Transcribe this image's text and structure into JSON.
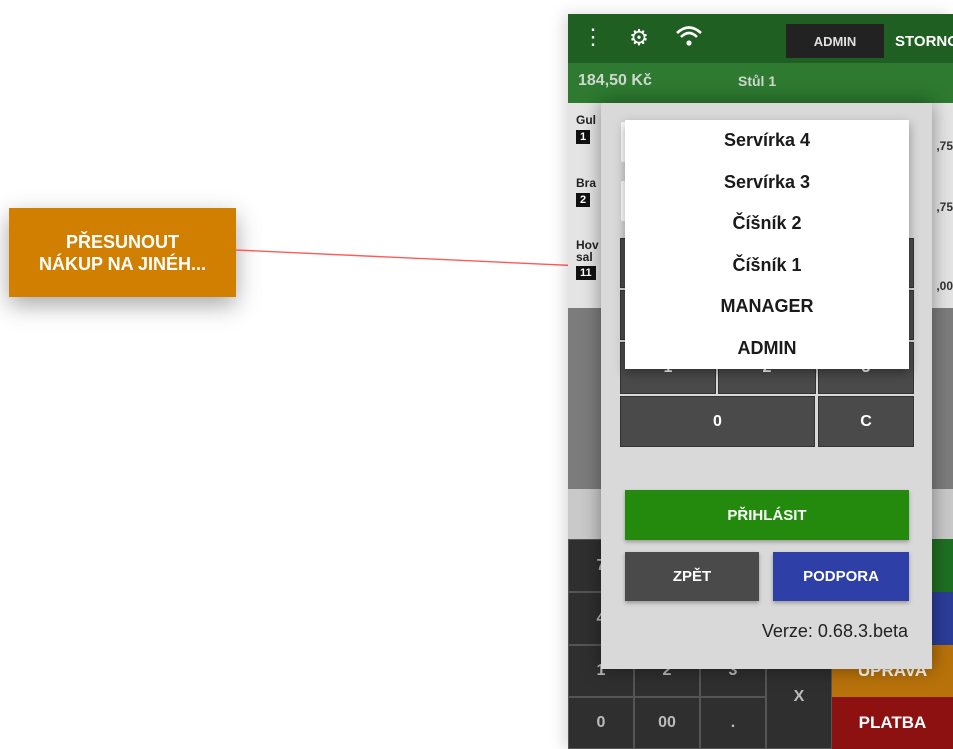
{
  "callout": {
    "line1": "PŘESUNOUT",
    "line2": "NÁKUP NA JINÉH..."
  },
  "topbar": {
    "menu_icon": "more-vertical-icon",
    "settings_icon": "gear-icon",
    "wifi_icon": "wifi-icon",
    "user_tab": "ADMIN",
    "storno_label": "STORNO",
    "colors": {
      "top": "#1f5f22",
      "sub": "#2d7a30"
    }
  },
  "order": {
    "total": "184,50 Kč",
    "table": "Stůl 1",
    "items": [
      {
        "name": "Gul",
        "qty": "1",
        "price": ",75"
      },
      {
        "name": "Bra",
        "qty": "2",
        "price": ",75"
      },
      {
        "name": "Hov sal",
        "qty": "11",
        "price": ",00"
      }
    ]
  },
  "keypad": {
    "rows": [
      [
        "7",
        "",
        ""
      ],
      [
        "4",
        "",
        ""
      ],
      [
        "1",
        "2",
        "3"
      ],
      [
        "0",
        "00",
        "."
      ]
    ],
    "x_label": "X",
    "edit_label": "ÚPRAVA",
    "pay_label": "PLATBA"
  },
  "dialog": {
    "keys": [
      "1",
      "2",
      "3",
      "0",
      "C"
    ],
    "login_label": "PŘIHLÁSIT",
    "back_label": "ZPĚT",
    "support_label": "PODPORA",
    "version": "Verze: 0.68.3.beta",
    "colors": {
      "login": "#238a0e",
      "support": "#2e3fa8"
    }
  },
  "user_dropdown": {
    "options": [
      "Servírka 4",
      "Servírka 3",
      "Číšník 2",
      "Číšník 1",
      "MANAGER",
      "ADMIN"
    ]
  }
}
